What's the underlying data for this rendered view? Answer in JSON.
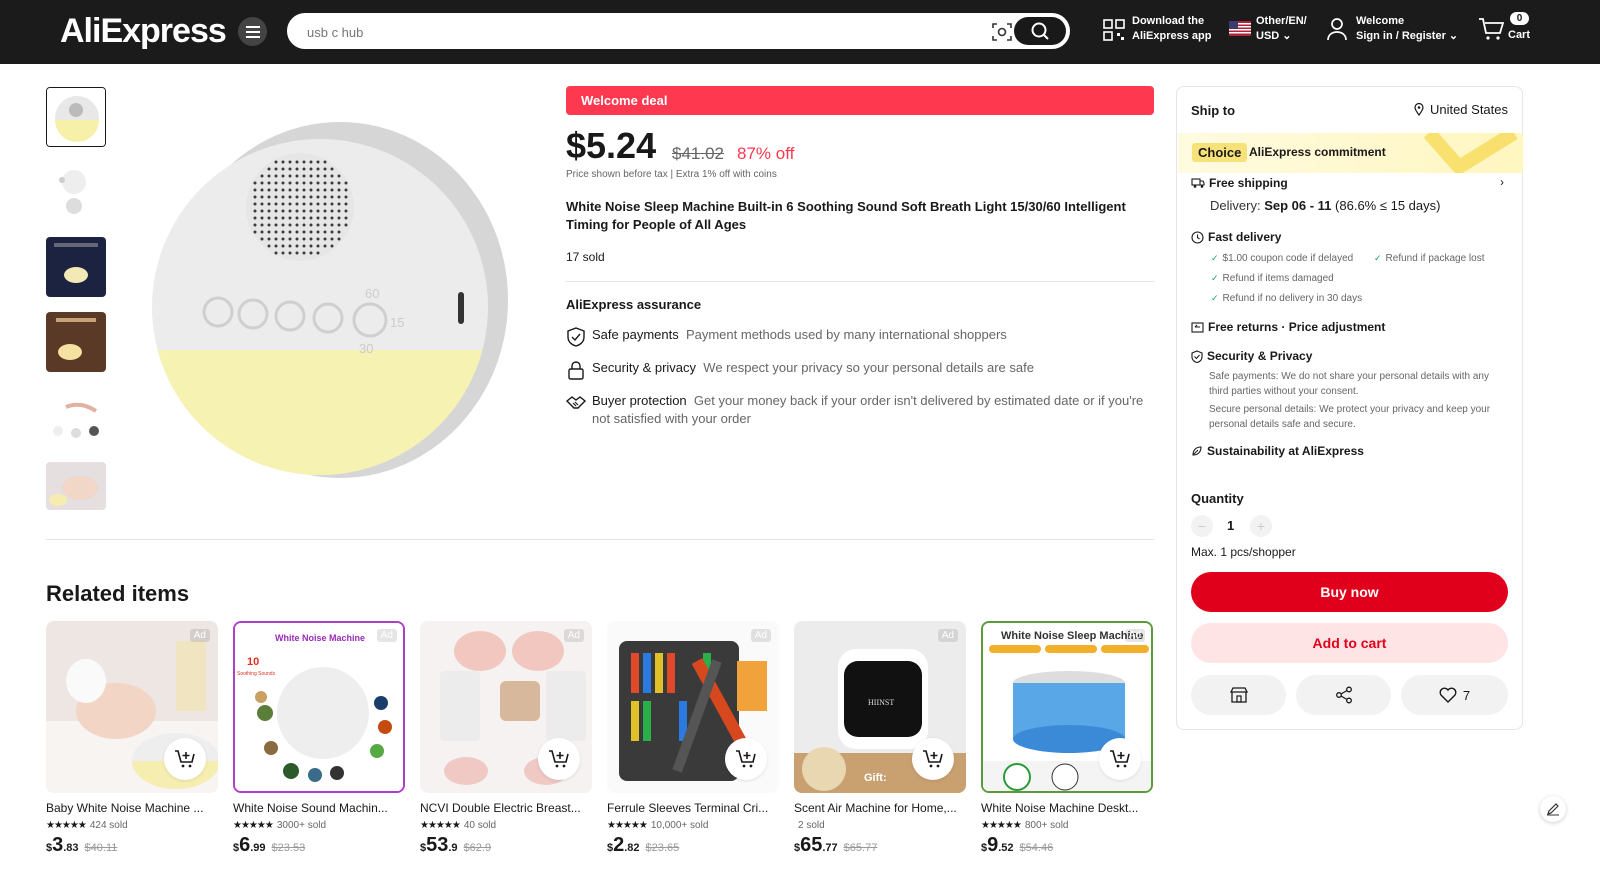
{
  "header": {
    "logo": "AliExpress",
    "search_placeholder": "usb c hub",
    "download_line1": "Download the",
    "download_line2": "AliExpress app",
    "locale_line1": "Other/EN/",
    "locale_line2": "USD",
    "account_line1": "Welcome",
    "account_line2": "Sign in / Register",
    "cart_count": "0",
    "cart_label": "Cart"
  },
  "product": {
    "welcome_deal": "Welcome deal",
    "price": "$5.24",
    "original_price": "$41.02",
    "discount": "87% off",
    "tax_note": "Price shown before tax  |  Extra 1% off with coins",
    "title": "White Noise Sleep Machine Built-in 6 Soothing Sound Soft Breath Light 15/30/60 Intelligent Timing for People of All Ages",
    "sold": "17 sold",
    "timer_labels": [
      "60",
      "15",
      "30"
    ]
  },
  "assurance": {
    "title": "AliExpress assurance",
    "items": [
      {
        "label": "Safe payments",
        "desc": "Payment methods used by many international shoppers",
        "icon": "shield-check-icon"
      },
      {
        "label": "Security & privacy",
        "desc": "We respect your privacy so your personal details are safe",
        "icon": "lock-icon"
      },
      {
        "label": "Buyer protection",
        "desc": "Get your money back if your order isn't delivered by estimated date or if you're not satisfied with your order",
        "icon": "handshake-icon"
      }
    ]
  },
  "shipping": {
    "ship_to_label": "Ship to",
    "country": "United States",
    "choice_tag": "Choice",
    "commitment": "AliExpress commitment",
    "free_shipping": "Free shipping",
    "delivery_label": "Delivery:",
    "delivery_dates": "Sep 06 - 11",
    "delivery_stat": "(86.6% ≤ 15 days)",
    "fast_delivery": "Fast delivery",
    "fast_items": [
      "$1.00 coupon code if delayed",
      "Refund if package lost",
      "Refund if items damaged",
      "Refund if no delivery in 30 days"
    ],
    "free_returns": "Free returns · Price adjustment",
    "security_title": "Security & Privacy",
    "security_text1": "Safe payments: We do not share your personal details with any third parties without your consent.",
    "security_text2": "Secure personal details: We protect your privacy and keep your personal details safe and secure.",
    "sustainability": "Sustainability at AliExpress",
    "quantity_label": "Quantity",
    "quantity_value": "1",
    "max_note": "Max. 1 pcs/shopper",
    "buy_now": "Buy now",
    "add_to_cart": "Add to cart",
    "wishlist_count": "7"
  },
  "related": {
    "title": "Related items",
    "ad_label": "Ad",
    "items": [
      {
        "name": "Baby White Noise Machine ...",
        "stars": "★★★★★",
        "sold": "424 sold",
        "cur": "$",
        "int": "3",
        "dec": ".83",
        "old": "$40.11"
      },
      {
        "name": "White Noise Sound Machin...",
        "stars": "★★★★★",
        "sold": "3000+ sold",
        "cur": "$",
        "int": "6",
        "dec": ".99",
        "old": "$23.53",
        "img_title": "White Noise Machine",
        "img_sub_num": "10",
        "img_sub_text": "Soothing Sounds"
      },
      {
        "name": "NCVI Double Electric Breast...",
        "stars": "★★★★★",
        "sold": "40 sold",
        "cur": "$",
        "int": "53",
        "dec": ".9",
        "old": "$62.9"
      },
      {
        "name": "Ferrule Sleeves Terminal Cri...",
        "stars": "★★★★★",
        "sold": "10,000+ sold",
        "cur": "$",
        "int": "2",
        "dec": ".82",
        "old": "$23.65"
      },
      {
        "name": "Scent Air Machine for Home,...",
        "stars": "",
        "sold": "2 sold",
        "cur": "$",
        "int": "65",
        "dec": ".77",
        "old": "$65.77",
        "img_brand": "HIINST",
        "img_gift": "Gift:"
      },
      {
        "name": "White Noise Machine Deskt...",
        "stars": "★★★★★",
        "sold": "800+ sold",
        "cur": "$",
        "int": "9",
        "dec": ".52",
        "old": "$54.46",
        "img_title": "White Noise Sleep Machine"
      }
    ]
  }
}
